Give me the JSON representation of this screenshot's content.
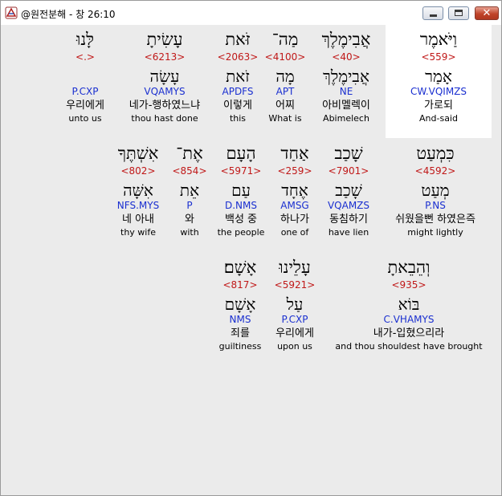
{
  "window": {
    "title": "@원전분해 - 창 26:10",
    "buttons": {
      "minimize": "minimize",
      "maximize": "maximize",
      "close": "✕"
    }
  },
  "rows": [
    {
      "words": [
        {
          "id": "w559",
          "heb": "וַיֹּאמֶר",
          "strong": "<559>",
          "lemma": "אָמַר",
          "morph": "CW.VQIMZS",
          "korean": "가로되",
          "english": "And-said",
          "highlighted": true
        },
        {
          "id": "w40",
          "heb": "אֲבִימֶלֶךְ",
          "strong": "<40>",
          "lemma": "אֲבִימֶלֶךְ",
          "morph": "NE",
          "korean": "아비멜렉이",
          "english": "Abimelech"
        },
        {
          "id": "w4100",
          "heb": "מַה־",
          "strong": "<4100>",
          "lemma": "מָה",
          "morph": "APT",
          "korean": "어찌",
          "english": "What is"
        },
        {
          "id": "w2063",
          "heb": "זֹּאת",
          "strong": "<2063>",
          "lemma": "זֹאת",
          "morph": "APDFS",
          "korean": "이렇게",
          "english": "this"
        },
        {
          "id": "w6213",
          "heb": "עָשִׂיתָ",
          "strong": "<6213>",
          "lemma": "עָשָׂה",
          "morph": "VQAMYS",
          "korean": "네가-행하였느냐",
          "english": "thou hast done"
        },
        {
          "id": "wlanu",
          "heb": "לָּנוּ",
          "strong": "<.>",
          "lemma": "",
          "morph": "P.CXP",
          "korean": "우리에게",
          "english": "unto us"
        }
      ]
    },
    {
      "words": [
        {
          "id": "w4592",
          "heb": "כִּמְעַט",
          "strong": "<4592>",
          "lemma": "מְעַט",
          "morph": "P.NS",
          "korean": "쉬웠을뻔 하였은즉",
          "english": "might lightly"
        },
        {
          "id": "w7901",
          "heb": "שָׁכַב",
          "strong": "<7901>",
          "lemma": "שָׁכַב",
          "morph": "VQAMZS",
          "korean": "동침하기",
          "english": "have lien"
        },
        {
          "id": "w259",
          "heb": "אַחַד",
          "strong": "<259>",
          "lemma": "אֶחָד",
          "morph": "AMSG",
          "korean": "하나가",
          "english": "one of"
        },
        {
          "id": "w5971",
          "heb": "הָעָם",
          "strong": "<5971>",
          "lemma": "עַם",
          "morph": "D.NMS",
          "korean": "백성 중",
          "english": "the people"
        },
        {
          "id": "w854",
          "heb": "אֶת־",
          "strong": "<854>",
          "lemma": "אֵת",
          "morph": "P",
          "korean": "와",
          "english": "with"
        },
        {
          "id": "w802",
          "heb": "אִשְׁתֶּךָ",
          "strong": "<802>",
          "lemma": "אִשָּׁה",
          "morph": "NFS.MYS",
          "korean": "네 아내",
          "english": "thy wife"
        }
      ]
    },
    {
      "words": [
        {
          "id": "w935",
          "heb": "וְהֵבֵאתָ",
          "strong": "<935>",
          "lemma": "בּוֹא",
          "morph": "C.VHAMYS",
          "korean": "내가-입혔으리라",
          "english": "and thou shouldest have brought"
        },
        {
          "id": "w5921",
          "heb": "עָלֵינוּ",
          "strong": "<5921>",
          "lemma": "עַל",
          "morph": "P.CXP",
          "korean": "우리에게",
          "english": "upon us"
        },
        {
          "id": "w817",
          "heb": "אָשָׁם׃",
          "strong": "<817>",
          "lemma": "אָשָׁם",
          "morph": "NMS",
          "korean": "죄를",
          "english": "guiltiness"
        }
      ]
    }
  ]
}
